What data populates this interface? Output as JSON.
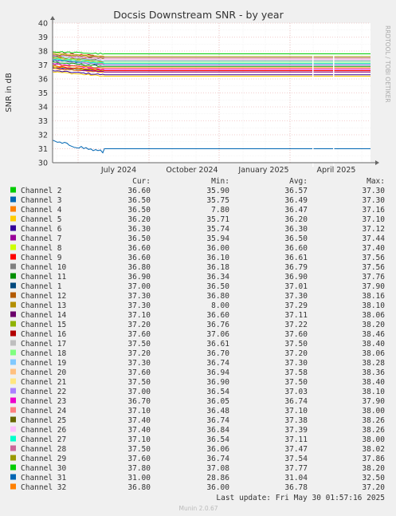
{
  "chart_data": {
    "type": "line",
    "title": "Docsis Downstream SNR - by year",
    "ylabel": "SNR in dB",
    "side_label": "RRDTOOL / TOBI OETIKER",
    "ylim": [
      30,
      40
    ],
    "yticks": [
      "30",
      "31",
      "32",
      "33",
      "34",
      "35",
      "36",
      "37",
      "38",
      "39",
      "40"
    ],
    "xticks": [
      "July 2024",
      "October 2024",
      "January 2025",
      "April 2025"
    ],
    "grid": true,
    "legend_headers": {
      "cur": "Cur:",
      "min": "Min:",
      "avg": "Avg:",
      "max": "Max:"
    },
    "series": [
      {
        "name": "Channel 2",
        "color": "#00cc00",
        "cur": "36.60",
        "min": "35.90",
        "avg": "36.57",
        "max": "37.30"
      },
      {
        "name": "Channel 3",
        "color": "#0066b3",
        "cur": "36.50",
        "min": "35.75",
        "avg": "36.49",
        "max": "37.30"
      },
      {
        "name": "Channel 4",
        "color": "#ff8000",
        "cur": "36.50",
        "min": "7.80",
        "avg": "36.47",
        "max": "37.16"
      },
      {
        "name": "Channel 5",
        "color": "#ffcc00",
        "cur": "36.20",
        "min": "35.71",
        "avg": "36.20",
        "max": "37.10"
      },
      {
        "name": "Channel 6",
        "color": "#330099",
        "cur": "36.30",
        "min": "35.74",
        "avg": "36.30",
        "max": "37.12"
      },
      {
        "name": "Channel 7",
        "color": "#990099",
        "cur": "36.50",
        "min": "35.94",
        "avg": "36.50",
        "max": "37.44"
      },
      {
        "name": "Channel 8",
        "color": "#ccff00",
        "cur": "36.60",
        "min": "36.00",
        "avg": "36.60",
        "max": "37.40"
      },
      {
        "name": "Channel 9",
        "color": "#ff0000",
        "cur": "36.60",
        "min": "36.10",
        "avg": "36.61",
        "max": "37.56"
      },
      {
        "name": "Channel 10",
        "color": "#808080",
        "cur": "36.80",
        "min": "36.18",
        "avg": "36.79",
        "max": "37.56"
      },
      {
        "name": "Channel 11",
        "color": "#008f00",
        "cur": "36.90",
        "min": "36.34",
        "avg": "36.90",
        "max": "37.76"
      },
      {
        "name": "Channel 1",
        "color": "#00487d",
        "cur": "37.00",
        "min": "36.50",
        "avg": "37.01",
        "max": "37.90"
      },
      {
        "name": "Channel 12",
        "color": "#b35a00",
        "cur": "37.30",
        "min": "36.80",
        "avg": "37.30",
        "max": "38.16"
      },
      {
        "name": "Channel 13",
        "color": "#b38f00",
        "cur": "37.30",
        "min": "8.00",
        "avg": "37.29",
        "max": "38.10"
      },
      {
        "name": "Channel 14",
        "color": "#6b006b",
        "cur": "37.10",
        "min": "36.60",
        "avg": "37.11",
        "max": "38.06"
      },
      {
        "name": "Channel 15",
        "color": "#8fb300",
        "cur": "37.20",
        "min": "36.76",
        "avg": "37.22",
        "max": "38.20"
      },
      {
        "name": "Channel 16",
        "color": "#b30000",
        "cur": "37.60",
        "min": "37.06",
        "avg": "37.60",
        "max": "38.46"
      },
      {
        "name": "Channel 17",
        "color": "#bebebe",
        "cur": "37.50",
        "min": "36.61",
        "avg": "37.50",
        "max": "38.40"
      },
      {
        "name": "Channel 18",
        "color": "#80ff80",
        "cur": "37.20",
        "min": "36.70",
        "avg": "37.20",
        "max": "38.06"
      },
      {
        "name": "Channel 19",
        "color": "#80c9ff",
        "cur": "37.30",
        "min": "36.74",
        "avg": "37.30",
        "max": "38.28"
      },
      {
        "name": "Channel 20",
        "color": "#ffc080",
        "cur": "37.60",
        "min": "36.94",
        "avg": "37.58",
        "max": "38.36"
      },
      {
        "name": "Channel 21",
        "color": "#ffe680",
        "cur": "37.50",
        "min": "36.90",
        "avg": "37.50",
        "max": "38.40"
      },
      {
        "name": "Channel 22",
        "color": "#aa80ff",
        "cur": "37.00",
        "min": "36.54",
        "avg": "37.03",
        "max": "38.10"
      },
      {
        "name": "Channel 23",
        "color": "#ee00cc",
        "cur": "36.70",
        "min": "36.05",
        "avg": "36.74",
        "max": "37.90"
      },
      {
        "name": "Channel 24",
        "color": "#ff8080",
        "cur": "37.10",
        "min": "36.48",
        "avg": "37.10",
        "max": "38.00"
      },
      {
        "name": "Channel 25",
        "color": "#666600",
        "cur": "37.40",
        "min": "36.74",
        "avg": "37.38",
        "max": "38.26"
      },
      {
        "name": "Channel 26",
        "color": "#ffbfff",
        "cur": "37.40",
        "min": "36.84",
        "avg": "37.39",
        "max": "38.26"
      },
      {
        "name": "Channel 27",
        "color": "#00ffcc",
        "cur": "37.10",
        "min": "36.54",
        "avg": "37.11",
        "max": "38.00"
      },
      {
        "name": "Channel 28",
        "color": "#cc6699",
        "cur": "37.50",
        "min": "36.06",
        "avg": "37.47",
        "max": "38.02"
      },
      {
        "name": "Channel 29",
        "color": "#999900",
        "cur": "37.60",
        "min": "36.74",
        "avg": "37.54",
        "max": "37.86"
      },
      {
        "name": "Channel 30",
        "color": "#00cc00",
        "cur": "37.80",
        "min": "37.08",
        "avg": "37.77",
        "max": "38.20"
      },
      {
        "name": "Channel 31",
        "color": "#0066b3",
        "cur": "31.00",
        "min": "28.86",
        "avg": "31.04",
        "max": "32.50"
      },
      {
        "name": "Channel 32",
        "color": "#ff8000",
        "cur": "36.80",
        "min": "36.00",
        "avg": "36.78",
        "max": "37.20"
      }
    ],
    "last_update": "Last update: Fri May 30 01:57:16 2025",
    "footer": "Munin 2.0.67"
  }
}
